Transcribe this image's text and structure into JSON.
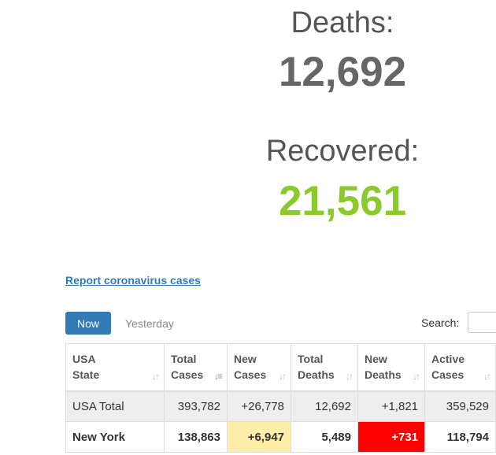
{
  "stats": {
    "deaths_label": "Deaths:",
    "deaths_value": "12,692",
    "recovered_label": "Recovered:",
    "recovered_value": "21,561"
  },
  "report_link": "Report coronavirus cases",
  "tabs": {
    "now": "Now",
    "yesterday": "Yesterday"
  },
  "search": {
    "label": "Search:",
    "value": ""
  },
  "table": {
    "headers": [
      {
        "line1": "USA",
        "line2": "State"
      },
      {
        "line1": "Total",
        "line2": "Cases"
      },
      {
        "line1": "New",
        "line2": "Cases"
      },
      {
        "line1": "Total",
        "line2": "Deaths"
      },
      {
        "line1": "New",
        "line2": "Deaths"
      },
      {
        "line1": "Active",
        "line2": "Cases"
      }
    ],
    "rows": [
      [
        "USA Total",
        "393,782",
        "+26,778",
        "12,692",
        "+1,821",
        "359,529"
      ],
      [
        "New York",
        "138,863",
        "+6,947",
        "5,489",
        "+731",
        "118,794"
      ]
    ]
  },
  "colors": {
    "recovered": "#8ACA2B",
    "primary": "#337ab7",
    "highlight_yellow": "#ffeeaa",
    "highlight_red": "#ff0000"
  }
}
